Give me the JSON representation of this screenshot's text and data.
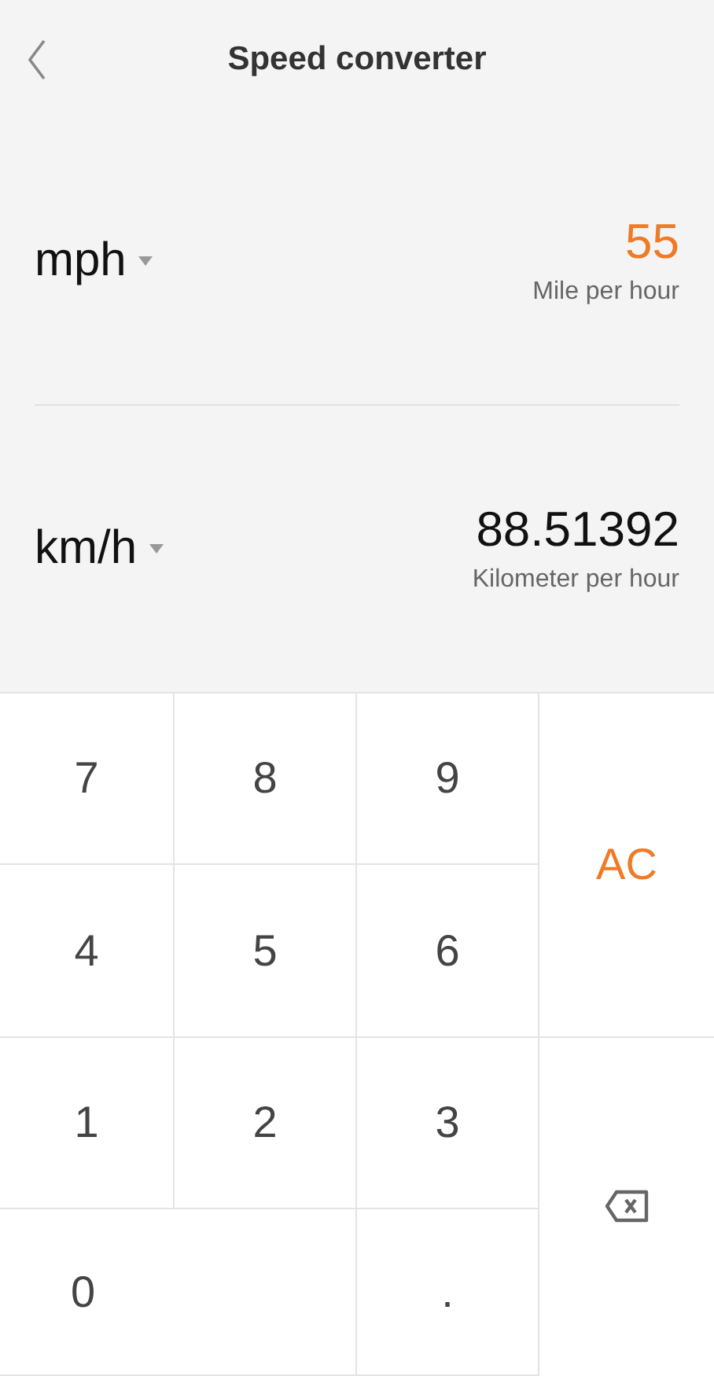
{
  "header": {
    "title": "Speed converter"
  },
  "units": [
    {
      "unit": "mph",
      "value": "55",
      "name": "Mile per hour",
      "selected": true
    },
    {
      "unit": "km/h",
      "value": "88.51392",
      "name": "Kilometer per hour",
      "selected": false
    }
  ],
  "keypad": [
    {
      "kind": "digit",
      "label": "7"
    },
    {
      "kind": "digit",
      "label": "8"
    },
    {
      "kind": "digit",
      "label": "9"
    },
    {
      "kind": "clear",
      "label": "AC"
    },
    {
      "kind": "digit",
      "label": "4"
    },
    {
      "kind": "digit",
      "label": "5"
    },
    {
      "kind": "digit",
      "label": "6"
    },
    {
      "kind": "digit",
      "label": "1"
    },
    {
      "kind": "digit",
      "label": "2"
    },
    {
      "kind": "digit",
      "label": "3"
    },
    {
      "kind": "backspace"
    },
    {
      "kind": "wide",
      "label": "0"
    },
    {
      "kind": "digit",
      "label": "."
    }
  ]
}
